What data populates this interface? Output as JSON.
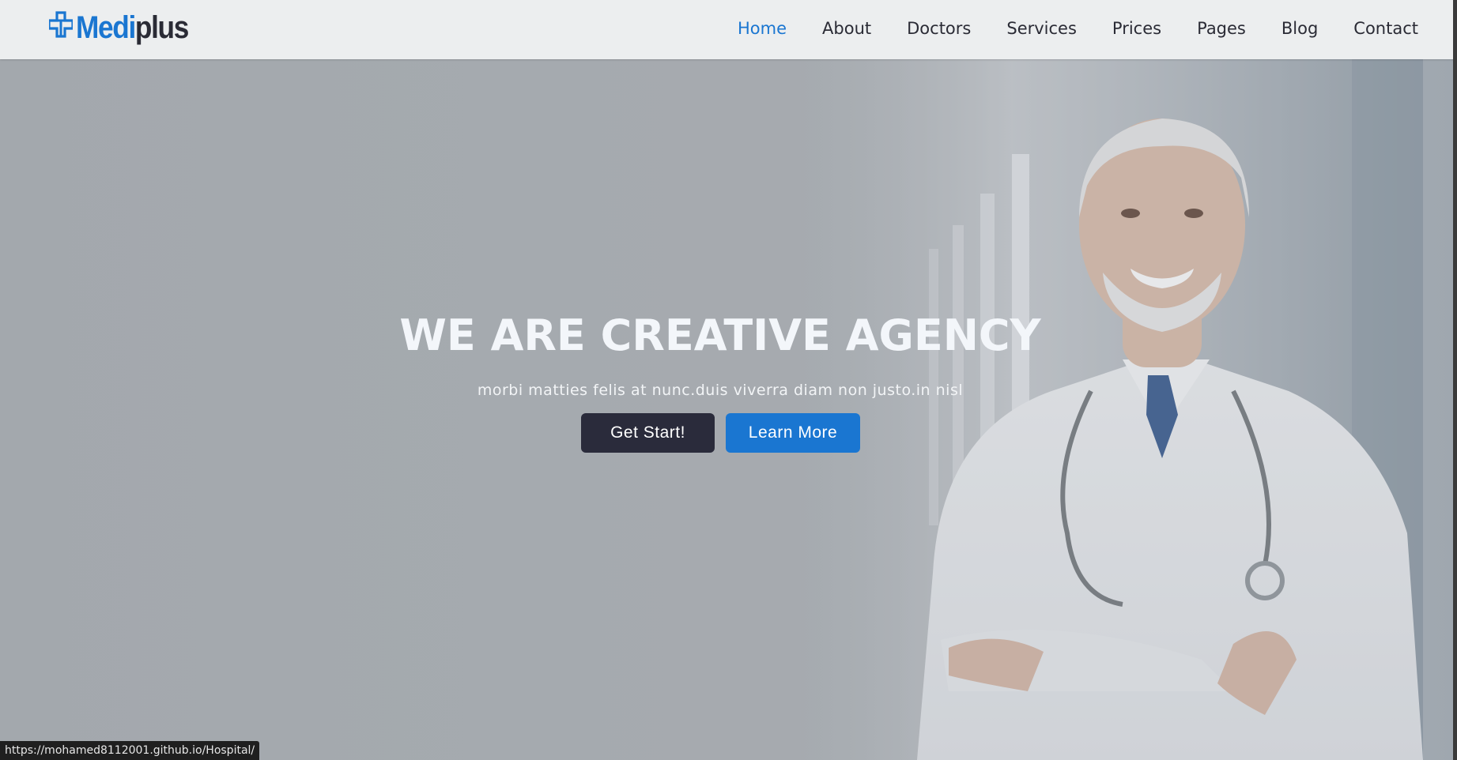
{
  "brand": {
    "logo_icon": "medical-cross-icon",
    "name_part1": "Medi",
    "name_part2": "plus",
    "primary_color": "#1a76d1",
    "dark_color": "#2a2b35"
  },
  "nav": {
    "items": [
      {
        "label": "Home",
        "active": true
      },
      {
        "label": "About",
        "active": false
      },
      {
        "label": "Doctors",
        "active": false
      },
      {
        "label": "Services",
        "active": false
      },
      {
        "label": "Prices",
        "active": false
      },
      {
        "label": "Pages",
        "active": false
      },
      {
        "label": "Blog",
        "active": false
      },
      {
        "label": "Contact",
        "active": false
      }
    ]
  },
  "hero": {
    "title": "WE ARE CREATIVE AGENCY",
    "subtitle": "morbi matties felis at nunc.duis viverra diam non justo.in nisl",
    "primary_button": "Get Start!",
    "secondary_button": "Learn More",
    "background_image": "doctor-portrait-image"
  },
  "status_bar": {
    "url": "https://mohamed8112001.github.io/Hospital/"
  }
}
